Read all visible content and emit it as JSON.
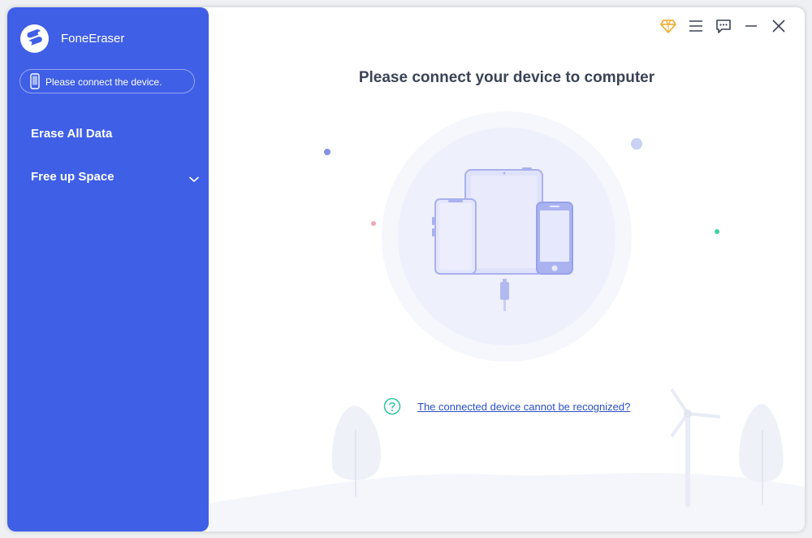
{
  "app": {
    "name": "FoneEraser",
    "device_status": "Please connect the device."
  },
  "sidebar": {
    "items": [
      {
        "label": "Erase All Data"
      },
      {
        "label": "Free up Space"
      }
    ]
  },
  "main": {
    "title": "Please connect your device to computer",
    "help_link": "The connected device cannot be recognized?"
  },
  "topbar": {
    "icons": [
      "diamond-icon",
      "menu-icon",
      "feedback-icon",
      "minimize-icon",
      "close-icon"
    ]
  },
  "colors": {
    "sidebar": "#3f5fe6",
    "accent": "#3f5fe6",
    "link": "#2b4fc7",
    "help_icon": "#2fc79a",
    "premium": "#f2a623"
  }
}
